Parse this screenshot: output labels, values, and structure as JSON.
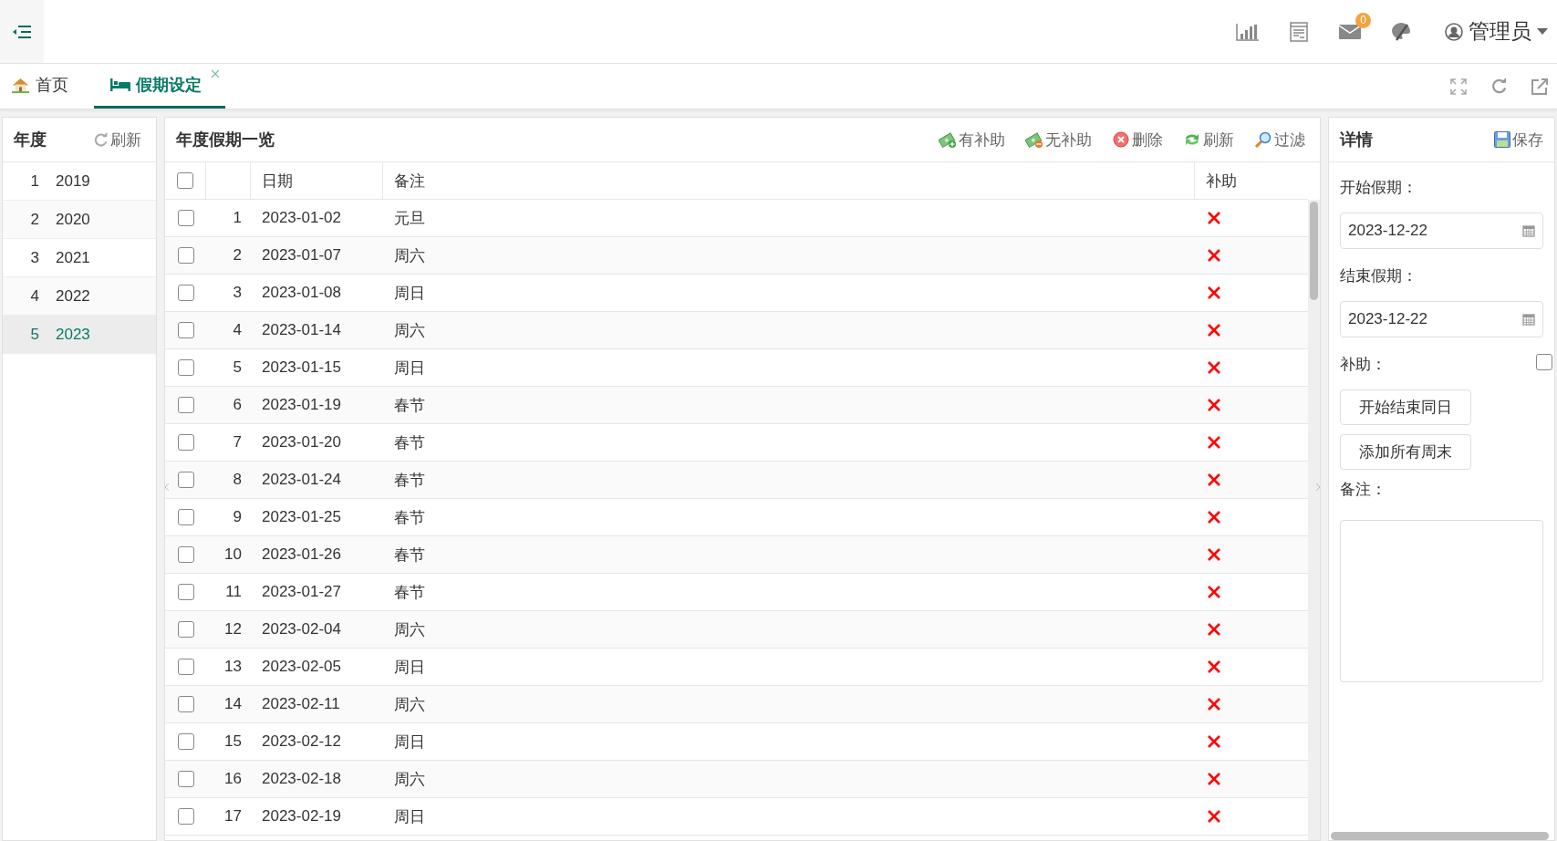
{
  "header": {
    "mail_badge": "0",
    "user": "管理员"
  },
  "tabs": [
    {
      "kind": "home",
      "label": "首页",
      "selected": false
    },
    {
      "kind": "bed",
      "label": "假期设定",
      "selected": true
    }
  ],
  "years": {
    "title": "年度",
    "refresh": "刷新",
    "items": [
      {
        "index": "1",
        "year": "2019",
        "selected": false
      },
      {
        "index": "2",
        "year": "2020",
        "selected": false
      },
      {
        "index": "3",
        "year": "2021",
        "selected": false
      },
      {
        "index": "4",
        "year": "2022",
        "selected": false
      },
      {
        "index": "5",
        "year": "2023",
        "selected": true
      }
    ]
  },
  "holidays": {
    "title": "年度假期一览",
    "toolbar": [
      {
        "kind": "add-subsidy",
        "label": "有补助"
      },
      {
        "kind": "no-subsidy",
        "label": "无补助"
      },
      {
        "kind": "delete",
        "label": "删除"
      },
      {
        "kind": "refresh",
        "label": "刷新"
      },
      {
        "kind": "filter",
        "label": "过滤"
      }
    ],
    "header_checked": false,
    "columns": [
      "日期",
      "备注",
      "补助"
    ],
    "rows": [
      {
        "checked": false,
        "index": "1",
        "date": "2023-01-02",
        "remark": "元旦",
        "subsidy": false
      },
      {
        "checked": false,
        "index": "2",
        "date": "2023-01-07",
        "remark": "周六",
        "subsidy": false
      },
      {
        "checked": false,
        "index": "3",
        "date": "2023-01-08",
        "remark": "周日",
        "subsidy": false
      },
      {
        "checked": false,
        "index": "4",
        "date": "2023-01-14",
        "remark": "周六",
        "subsidy": false
      },
      {
        "checked": false,
        "index": "5",
        "date": "2023-01-15",
        "remark": "周日",
        "subsidy": false
      },
      {
        "checked": false,
        "index": "6",
        "date": "2023-01-19",
        "remark": "春节",
        "subsidy": false
      },
      {
        "checked": false,
        "index": "7",
        "date": "2023-01-20",
        "remark": "春节",
        "subsidy": false
      },
      {
        "checked": false,
        "index": "8",
        "date": "2023-01-24",
        "remark": "春节",
        "subsidy": false
      },
      {
        "checked": false,
        "index": "9",
        "date": "2023-01-25",
        "remark": "春节",
        "subsidy": false
      },
      {
        "checked": false,
        "index": "10",
        "date": "2023-01-26",
        "remark": "春节",
        "subsidy": false
      },
      {
        "checked": false,
        "index": "11",
        "date": "2023-01-27",
        "remark": "春节",
        "subsidy": false
      },
      {
        "checked": false,
        "index": "12",
        "date": "2023-02-04",
        "remark": "周六",
        "subsidy": false
      },
      {
        "checked": false,
        "index": "13",
        "date": "2023-02-05",
        "remark": "周日",
        "subsidy": false
      },
      {
        "checked": false,
        "index": "14",
        "date": "2023-02-11",
        "remark": "周六",
        "subsidy": false
      },
      {
        "checked": false,
        "index": "15",
        "date": "2023-02-12",
        "remark": "周日",
        "subsidy": false
      },
      {
        "checked": false,
        "index": "16",
        "date": "2023-02-18",
        "remark": "周六",
        "subsidy": false
      },
      {
        "checked": false,
        "index": "17",
        "date": "2023-02-19",
        "remark": "周日",
        "subsidy": false
      }
    ]
  },
  "detail": {
    "title": "详情",
    "save": "保存",
    "start_label": "开始假期：",
    "start_value": "2023-12-22",
    "end_label": "结束假期：",
    "end_value": "2023-12-22",
    "subsidy_label": "补助：",
    "subsidy_checked": false,
    "buttons": [
      "开始结束同日",
      "添加所有周末"
    ],
    "remark_label": "备注："
  }
}
